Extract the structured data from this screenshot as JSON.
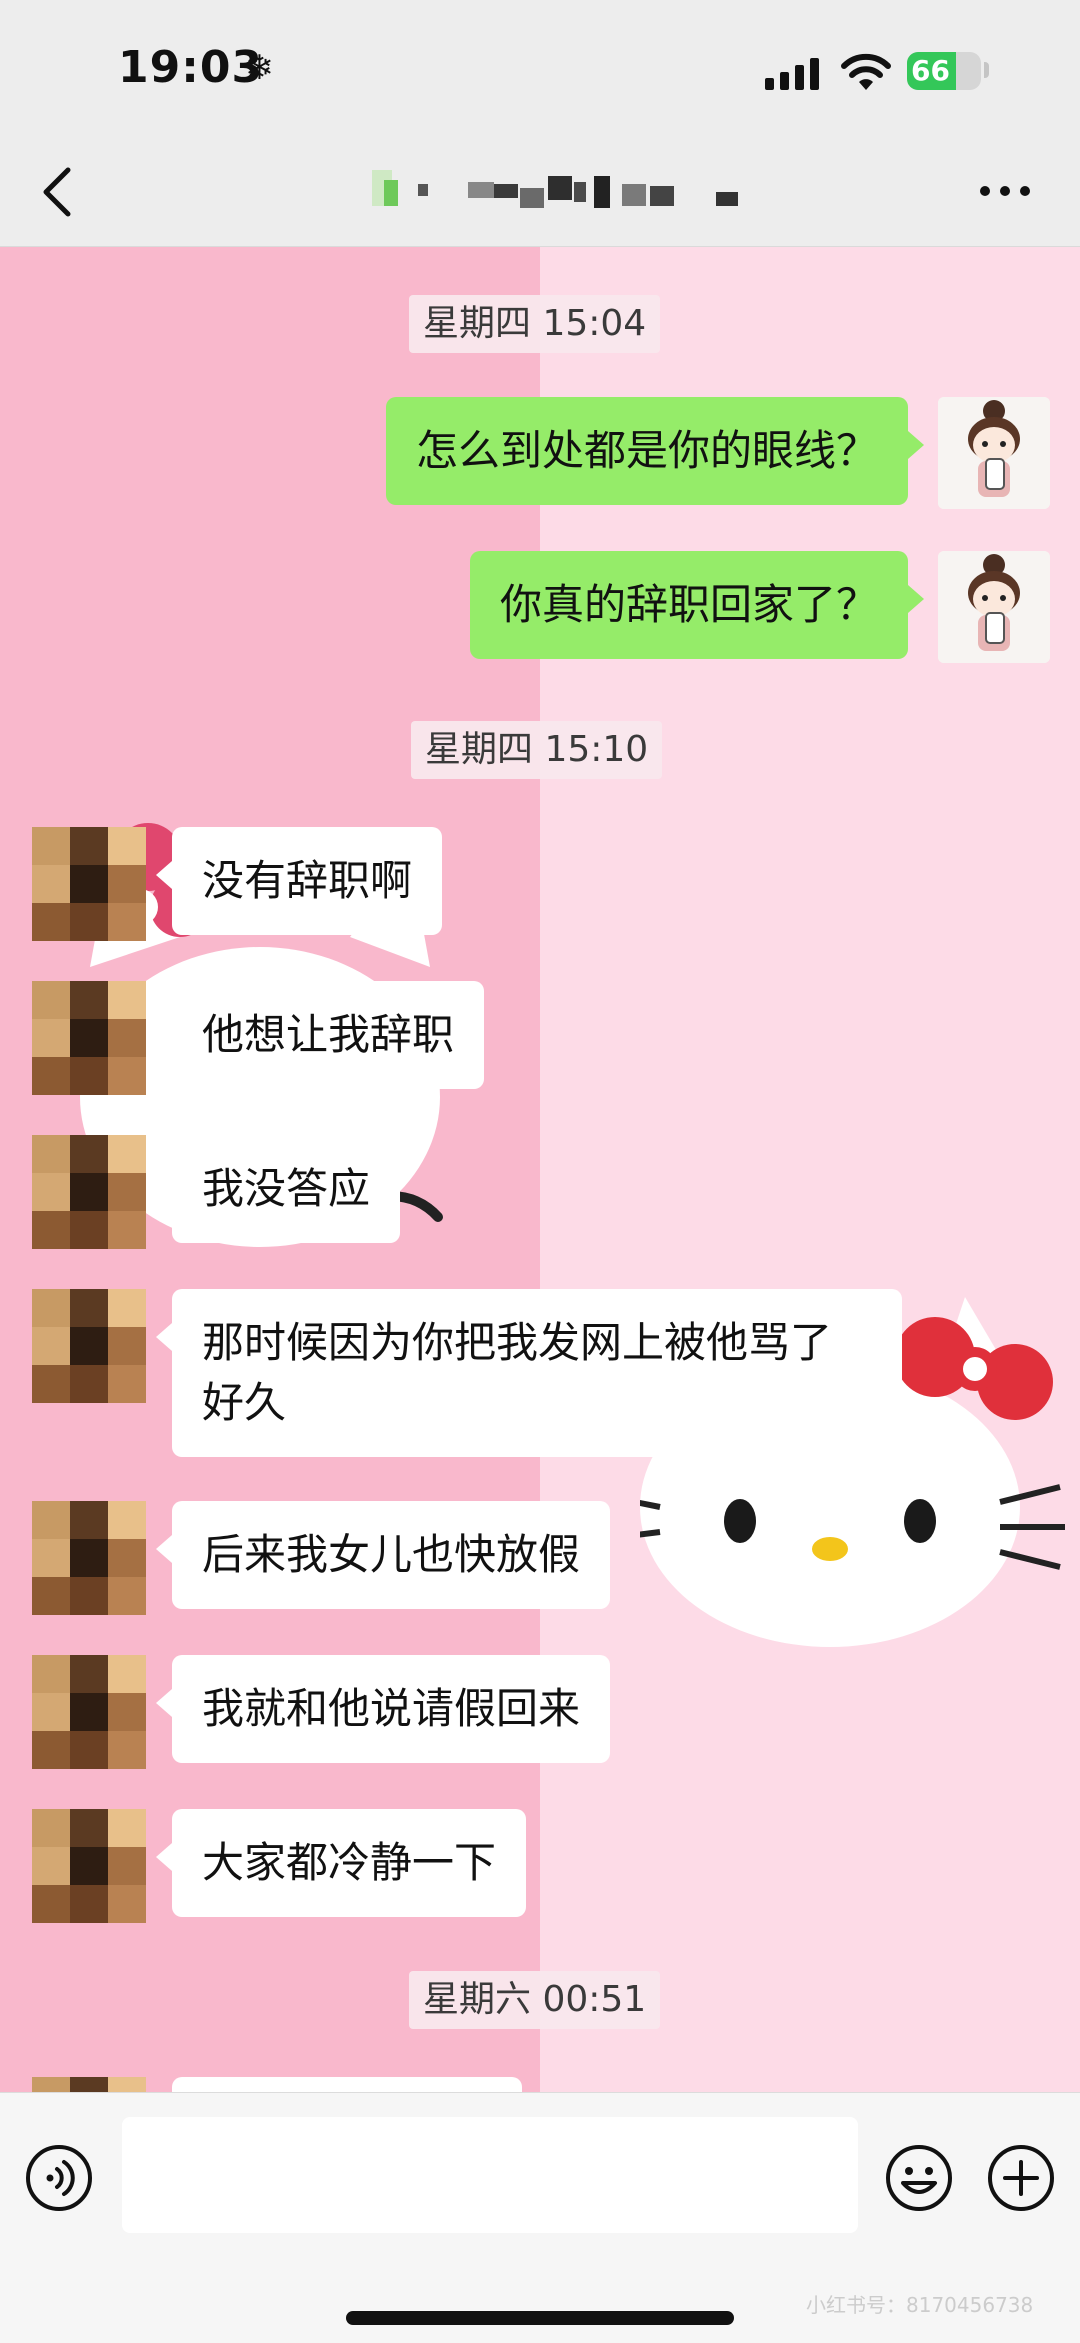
{
  "status_bar": {
    "time": "19:03",
    "battery": "66",
    "battery_percent": 66,
    "weather_icon": "snowflake-icon",
    "signal_icon": "cellular-signal-icon",
    "wifi_icon": "wifi-icon"
  },
  "nav": {
    "back_icon": "chevron-left-icon",
    "more_icon": "more-dots-icon",
    "title_pixelated": true
  },
  "chat": {
    "background_left": "#f9b8cc",
    "background_right": "#fddbe7",
    "timestamps": [
      "星期四 15:04",
      "星期四 15:10",
      "星期六 00:51"
    ],
    "outgoing": [
      "怎么到处都是你的眼线？",
      "你真的辞职回家了？"
    ],
    "incoming": [
      "没有辞职啊",
      "他想让我辞职",
      "我没答应",
      "那时候因为你把我发网上被他骂了好久",
      "后来我女儿也快放假",
      "我就和他说请假回来",
      "大家都冷静一下"
    ]
  },
  "input_bar": {
    "voice_icon": "voice-icon",
    "emoji_icon": "emoji-icon",
    "plus_icon": "plus-icon",
    "placeholder": ""
  },
  "colors": {
    "outgoing_bubble": "#95ec69",
    "incoming_bubble": "#ffffff",
    "battery_green": "#34c759"
  },
  "watermark": "小红书号：8170456738"
}
